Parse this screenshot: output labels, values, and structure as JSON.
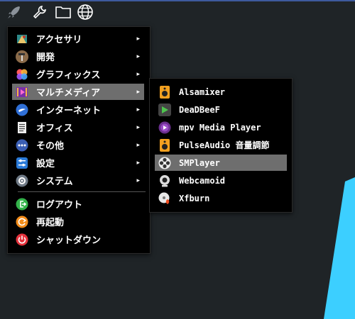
{
  "taskbar": {
    "icons": [
      "rocket-icon",
      "wrench-icon",
      "folder-icon",
      "globe-icon"
    ]
  },
  "main_menu": {
    "items": [
      {
        "label": "アクセサリ",
        "icon": "accessories-icon",
        "submenu": true
      },
      {
        "label": "開発",
        "icon": "hammer-icon",
        "submenu": true
      },
      {
        "label": "グラフィックス",
        "icon": "graphics-icon",
        "submenu": true
      },
      {
        "label": "マルチメディア",
        "icon": "multimedia-icon",
        "submenu": true,
        "selected": true
      },
      {
        "label": "インターネット",
        "icon": "internet-icon",
        "submenu": true
      },
      {
        "label": "オフィス",
        "icon": "office-icon",
        "submenu": true
      },
      {
        "label": "その他",
        "icon": "other-icon",
        "submenu": true
      },
      {
        "label": "設定",
        "icon": "settings-icon",
        "submenu": true
      },
      {
        "label": "システム",
        "icon": "system-icon",
        "submenu": true
      }
    ],
    "actions": [
      {
        "label": "ログアウト",
        "icon": "logout-icon"
      },
      {
        "label": "再起動",
        "icon": "reboot-icon"
      },
      {
        "label": "シャットダウン",
        "icon": "shutdown-icon"
      }
    ],
    "arrow": "▸"
  },
  "sub_menu": {
    "items": [
      {
        "label": "Alsamixer",
        "icon": "speaker-icon"
      },
      {
        "label": "DeaDBeeF",
        "icon": "deadbeef-icon"
      },
      {
        "label": "mpv Media Player",
        "icon": "mpv-icon"
      },
      {
        "label": "PulseAudio 音量調節",
        "icon": "speaker-icon"
      },
      {
        "label": "SMPlayer",
        "icon": "smplayer-icon",
        "selected": true
      },
      {
        "label": "Webcamoid",
        "icon": "webcam-icon"
      },
      {
        "label": "Xfburn",
        "icon": "disc-burn-icon"
      }
    ]
  },
  "colors": {
    "background": "#1f2427",
    "menu_bg": "#000000",
    "selected_bg": "#6e6e6e",
    "accent_shape": "#3ccfff"
  }
}
